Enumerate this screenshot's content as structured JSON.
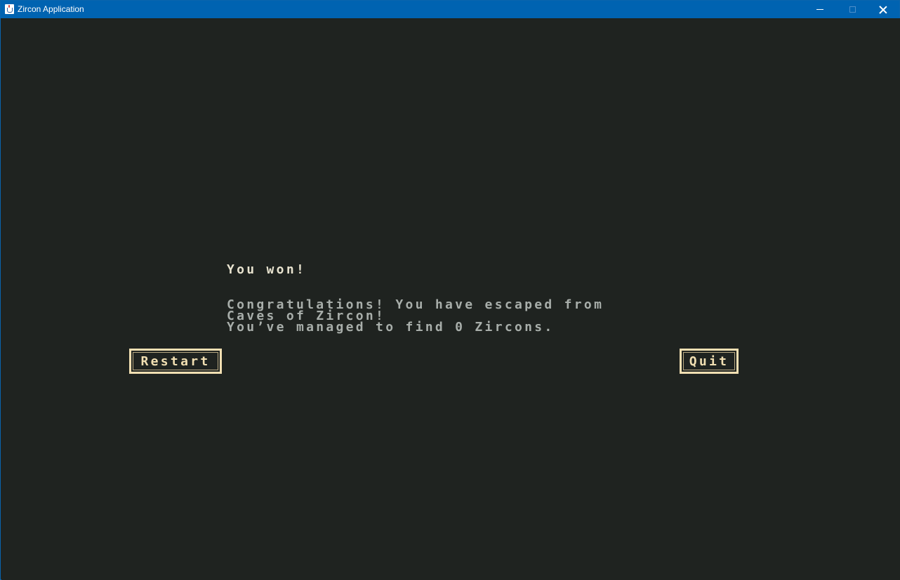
{
  "window": {
    "title": "Zircon Application",
    "icon": "java-cup-icon",
    "controls": [
      "minimize-icon",
      "maximize-icon",
      "close-icon"
    ]
  },
  "screen": {
    "heading": "You won!",
    "message_lines": [
      "Congratulations! You have escaped from",
      "Caves of Zircon!",
      "You’ve managed to find 0 Zircons."
    ],
    "buttons": {
      "restart_label": "Restart",
      "quit_label": "Quit"
    }
  },
  "colors": {
    "background": "#1f2320",
    "titlebar": "#0063b1",
    "heading_text": "#e8e3cf",
    "message_text": "#a8aeaa",
    "button": "#f1dfb2"
  }
}
